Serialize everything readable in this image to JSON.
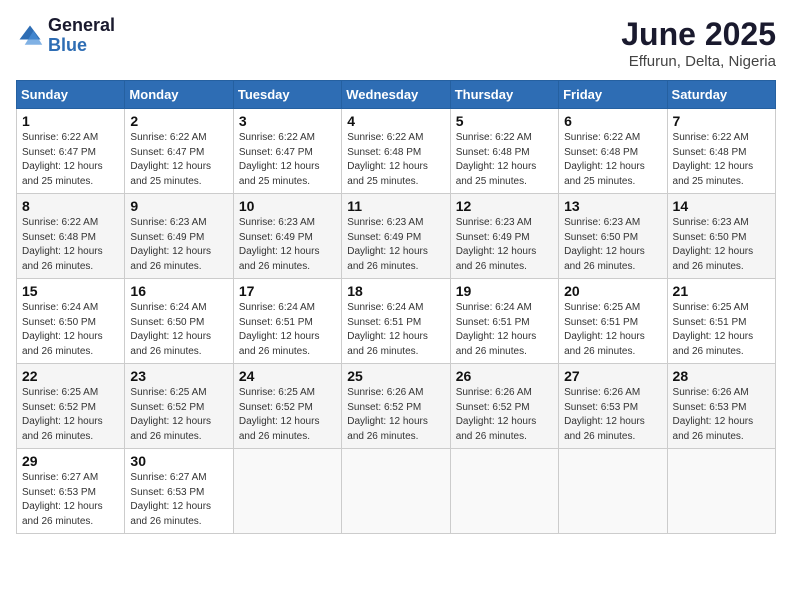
{
  "logo": {
    "general": "General",
    "blue": "Blue"
  },
  "header": {
    "month": "June 2025",
    "location": "Effurun, Delta, Nigeria"
  },
  "days_of_week": [
    "Sunday",
    "Monday",
    "Tuesday",
    "Wednesday",
    "Thursday",
    "Friday",
    "Saturday"
  ],
  "weeks": [
    [
      {
        "day": "1",
        "sunrise": "6:22 AM",
        "sunset": "6:47 PM",
        "daylight": "12 hours and 25 minutes."
      },
      {
        "day": "2",
        "sunrise": "6:22 AM",
        "sunset": "6:47 PM",
        "daylight": "12 hours and 25 minutes."
      },
      {
        "day": "3",
        "sunrise": "6:22 AM",
        "sunset": "6:47 PM",
        "daylight": "12 hours and 25 minutes."
      },
      {
        "day": "4",
        "sunrise": "6:22 AM",
        "sunset": "6:48 PM",
        "daylight": "12 hours and 25 minutes."
      },
      {
        "day": "5",
        "sunrise": "6:22 AM",
        "sunset": "6:48 PM",
        "daylight": "12 hours and 25 minutes."
      },
      {
        "day": "6",
        "sunrise": "6:22 AM",
        "sunset": "6:48 PM",
        "daylight": "12 hours and 25 minutes."
      },
      {
        "day": "7",
        "sunrise": "6:22 AM",
        "sunset": "6:48 PM",
        "daylight": "12 hours and 25 minutes."
      }
    ],
    [
      {
        "day": "8",
        "sunrise": "6:22 AM",
        "sunset": "6:48 PM",
        "daylight": "12 hours and 26 minutes."
      },
      {
        "day": "9",
        "sunrise": "6:23 AM",
        "sunset": "6:49 PM",
        "daylight": "12 hours and 26 minutes."
      },
      {
        "day": "10",
        "sunrise": "6:23 AM",
        "sunset": "6:49 PM",
        "daylight": "12 hours and 26 minutes."
      },
      {
        "day": "11",
        "sunrise": "6:23 AM",
        "sunset": "6:49 PM",
        "daylight": "12 hours and 26 minutes."
      },
      {
        "day": "12",
        "sunrise": "6:23 AM",
        "sunset": "6:49 PM",
        "daylight": "12 hours and 26 minutes."
      },
      {
        "day": "13",
        "sunrise": "6:23 AM",
        "sunset": "6:50 PM",
        "daylight": "12 hours and 26 minutes."
      },
      {
        "day": "14",
        "sunrise": "6:23 AM",
        "sunset": "6:50 PM",
        "daylight": "12 hours and 26 minutes."
      }
    ],
    [
      {
        "day": "15",
        "sunrise": "6:24 AM",
        "sunset": "6:50 PM",
        "daylight": "12 hours and 26 minutes."
      },
      {
        "day": "16",
        "sunrise": "6:24 AM",
        "sunset": "6:50 PM",
        "daylight": "12 hours and 26 minutes."
      },
      {
        "day": "17",
        "sunrise": "6:24 AM",
        "sunset": "6:51 PM",
        "daylight": "12 hours and 26 minutes."
      },
      {
        "day": "18",
        "sunrise": "6:24 AM",
        "sunset": "6:51 PM",
        "daylight": "12 hours and 26 minutes."
      },
      {
        "day": "19",
        "sunrise": "6:24 AM",
        "sunset": "6:51 PM",
        "daylight": "12 hours and 26 minutes."
      },
      {
        "day": "20",
        "sunrise": "6:25 AM",
        "sunset": "6:51 PM",
        "daylight": "12 hours and 26 minutes."
      },
      {
        "day": "21",
        "sunrise": "6:25 AM",
        "sunset": "6:51 PM",
        "daylight": "12 hours and 26 minutes."
      }
    ],
    [
      {
        "day": "22",
        "sunrise": "6:25 AM",
        "sunset": "6:52 PM",
        "daylight": "12 hours and 26 minutes."
      },
      {
        "day": "23",
        "sunrise": "6:25 AM",
        "sunset": "6:52 PM",
        "daylight": "12 hours and 26 minutes."
      },
      {
        "day": "24",
        "sunrise": "6:25 AM",
        "sunset": "6:52 PM",
        "daylight": "12 hours and 26 minutes."
      },
      {
        "day": "25",
        "sunrise": "6:26 AM",
        "sunset": "6:52 PM",
        "daylight": "12 hours and 26 minutes."
      },
      {
        "day": "26",
        "sunrise": "6:26 AM",
        "sunset": "6:52 PM",
        "daylight": "12 hours and 26 minutes."
      },
      {
        "day": "27",
        "sunrise": "6:26 AM",
        "sunset": "6:53 PM",
        "daylight": "12 hours and 26 minutes."
      },
      {
        "day": "28",
        "sunrise": "6:26 AM",
        "sunset": "6:53 PM",
        "daylight": "12 hours and 26 minutes."
      }
    ],
    [
      {
        "day": "29",
        "sunrise": "6:27 AM",
        "sunset": "6:53 PM",
        "daylight": "12 hours and 26 minutes."
      },
      {
        "day": "30",
        "sunrise": "6:27 AM",
        "sunset": "6:53 PM",
        "daylight": "12 hours and 26 minutes."
      },
      null,
      null,
      null,
      null,
      null
    ]
  ]
}
